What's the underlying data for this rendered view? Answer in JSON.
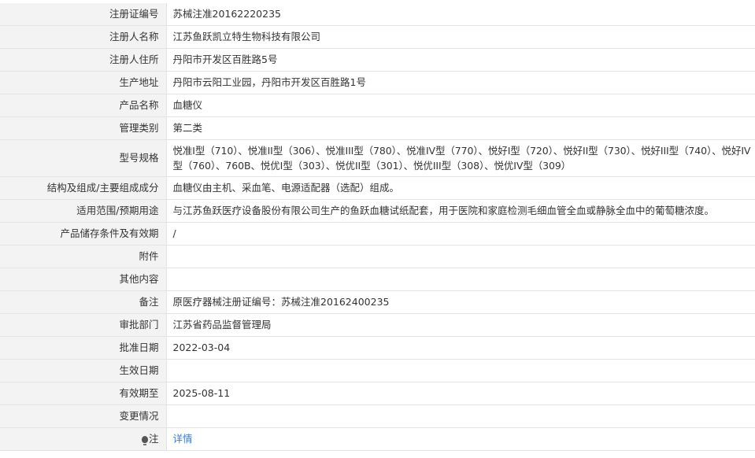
{
  "rows": [
    {
      "label": "注册证编号",
      "value": "苏械注准20162220235"
    },
    {
      "label": "注册人名称",
      "value": "江苏鱼跃凯立特生物科技有限公司"
    },
    {
      "label": "注册人住所",
      "value": "丹阳市开发区百胜路5号"
    },
    {
      "label": "生产地址",
      "value": "丹阳市云阳工业园，丹阳市开发区百胜路1号"
    },
    {
      "label": "产品名称",
      "value": "血糖仪"
    },
    {
      "label": "管理类别",
      "value": "第二类"
    },
    {
      "label": "型号规格",
      "value": "悦准I型（710）、悦准II型（306）、悦准III型（780）、悦准IV型（770）、悦好I型（720）、悦好II型（730）、悦好III型（740）、悦好IV型（760）、760B、悦优I型（303）、悦优II型（301）、悦优III型（308）、悦优IV型（309）"
    },
    {
      "label": "结构及组成/主要组成成分",
      "value": "血糖仪由主机、采血笔、电源适配器（选配）组成。"
    },
    {
      "label": "适用范围/预期用途",
      "value": "与江苏鱼跃医疗设备股份有限公司生产的鱼跃血糖试纸配套，用于医院和家庭检测毛细血管全血或静脉全血中的葡萄糖浓度。"
    },
    {
      "label": "产品储存条件及有效期",
      "value": "/"
    },
    {
      "label": "附件",
      "value": ""
    },
    {
      "label": "其他内容",
      "value": ""
    },
    {
      "label": "备注",
      "value": "原医疗器械注册证编号：苏械注准20162400235"
    },
    {
      "label": "审批部门",
      "value": "江苏省药品监督管理局"
    },
    {
      "label": "批准日期",
      "value": "2022-03-04"
    },
    {
      "label": "生效日期",
      "value": ""
    },
    {
      "label": "有效期至",
      "value": "2025-08-11"
    },
    {
      "label": "变更情况",
      "value": ""
    },
    {
      "label": "注",
      "value": "详情",
      "icon": "lightbulb-icon"
    }
  ]
}
